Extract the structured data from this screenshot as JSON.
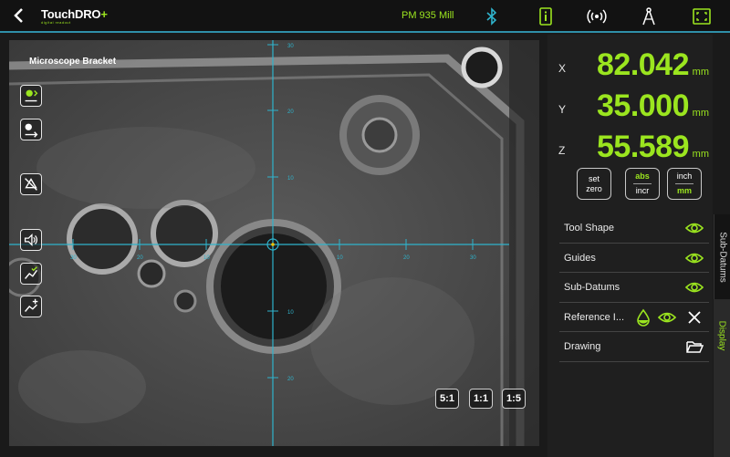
{
  "app": {
    "logo_main": "TouchDRO",
    "logo_plus": "+",
    "logo_sub": "digital readout",
    "machine_name": "PM 935 Mill"
  },
  "camera": {
    "title": "Microscope Bracket",
    "scale_labels": [
      "30",
      "20",
      "10",
      "10",
      "20",
      "30",
      "30",
      "20",
      "10",
      "10",
      "20"
    ],
    "zoom_buttons": [
      "5:1",
      "1:1",
      "1:5"
    ]
  },
  "dro": {
    "x": {
      "label": "X",
      "value": "82.042",
      "unit": "mm"
    },
    "y": {
      "label": "Y",
      "value": "35.000",
      "unit": "mm"
    },
    "z": {
      "label": "Z",
      "value": "55.589",
      "unit": "mm"
    }
  },
  "modes": {
    "set_zero": {
      "line1": "set",
      "line2": "zero"
    },
    "abs_incr": {
      "top": "abs",
      "bottom": "incr"
    },
    "inch_mm": {
      "top": "inch",
      "bottom": "mm"
    }
  },
  "display_list": {
    "tool_shape": "Tool Shape",
    "guides": "Guides",
    "sub_datums": "Sub-Datums",
    "reference_image": "Reference I...",
    "drawing": "Drawing"
  },
  "side_tabs": {
    "sub_datums": "Sub-Datums",
    "display": "Display"
  },
  "colors": {
    "accent": "#9be51f",
    "crosshair": "#2fb3cc",
    "topbar_border": "#2f8fa8"
  }
}
